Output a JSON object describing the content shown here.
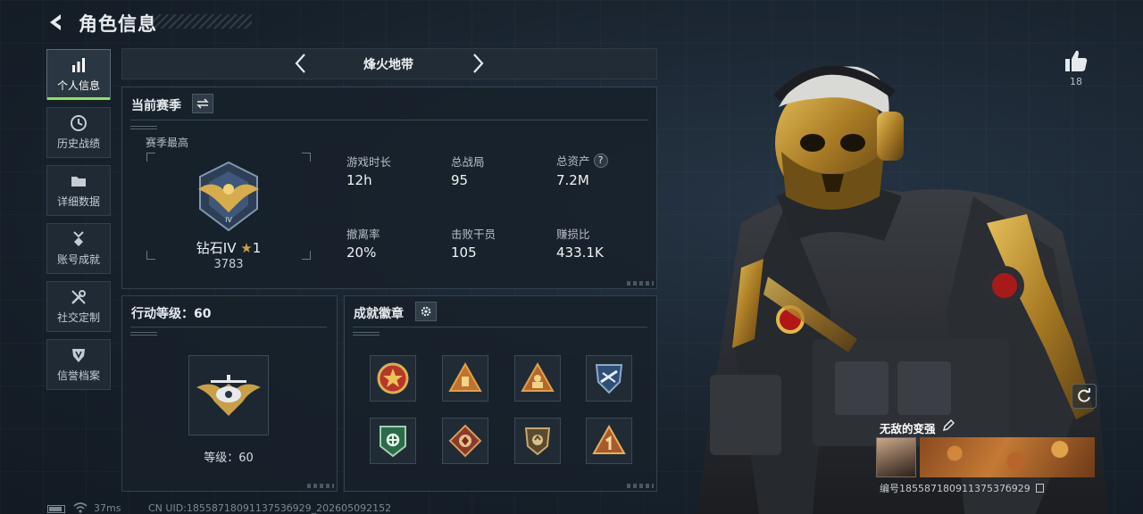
{
  "header": {
    "title": "角色信息"
  },
  "sidebar": {
    "items": [
      {
        "label": "个人信息",
        "icon": "bar-chart-icon",
        "active": true
      },
      {
        "label": "历史战绩",
        "icon": "clock-icon",
        "active": false
      },
      {
        "label": "详细数据",
        "icon": "folder-icon",
        "active": false
      },
      {
        "label": "账号成就",
        "icon": "medal-icon",
        "active": false
      },
      {
        "label": "社交定制",
        "icon": "tools-icon",
        "active": false
      },
      {
        "label": "信誉档案",
        "icon": "shield-icon",
        "active": false
      }
    ]
  },
  "mode": {
    "name": "烽火地带"
  },
  "season": {
    "title": "当前赛季",
    "best_label": "赛季最高",
    "rank_name": "钻石IV",
    "rank_stars": "1",
    "rank_score": "3783",
    "stats": [
      {
        "label": "游戏时长",
        "value": "12h"
      },
      {
        "label": "总战局",
        "value": "95"
      },
      {
        "label": "总资产",
        "value": "7.2M",
        "help": "?"
      },
      {
        "label": "撤离率",
        "value": "20%"
      },
      {
        "label": "击败干员",
        "value": "105"
      },
      {
        "label": "赚损比",
        "value": "433.1K"
      }
    ]
  },
  "level": {
    "title": "行动等级：60",
    "caption": "等级：60"
  },
  "achievements": {
    "title": "成就徽章",
    "badges": [
      "badge-red-star",
      "badge-orange-triangle",
      "badge-soldier-triangle",
      "badge-blue-shield",
      "badge-green-shield",
      "badge-red-diamond",
      "badge-bronze-shield",
      "badge-rank-triangle"
    ]
  },
  "profile": {
    "likes": "18",
    "card_name": "无敌的变强",
    "card_uid": "编号18558718091137537б929",
    "footer_uid": "CN UID:1855871809113753б929_202605092152",
    "ping": "37ms"
  },
  "colors": {
    "accent": "#8ee35a",
    "gold": "#c9a048",
    "bg": "#16202a"
  }
}
